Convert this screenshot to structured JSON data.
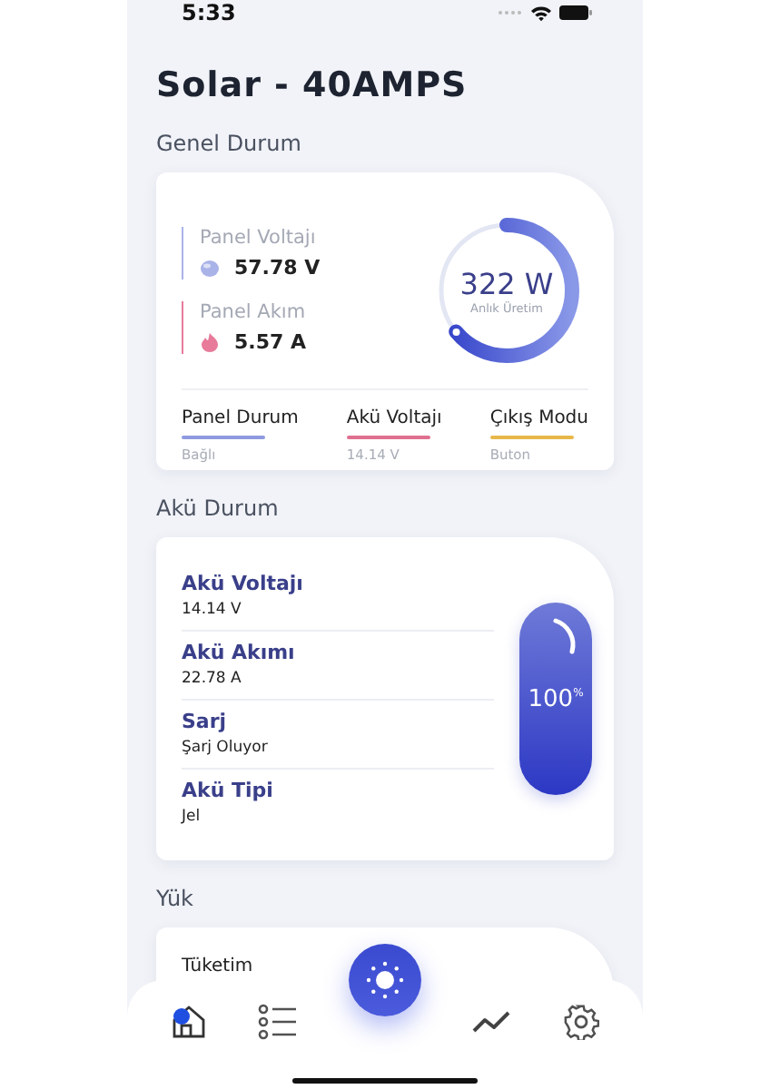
{
  "status_bar": {
    "time": "5:33"
  },
  "title": "Solar - 40AMPS",
  "general": {
    "heading": "Genel Durum",
    "metrics": [
      {
        "label": "Panel Voltajı",
        "value": "57.78 V",
        "color": "#a9b3e8"
      },
      {
        "label": "Panel Akım",
        "value": "5.57 A",
        "color": "#e87a9a"
      }
    ],
    "gauge": {
      "value": "322 W",
      "caption": "Anlık Üretim",
      "level": 0.64
    },
    "stats": [
      {
        "label": "Panel Durum",
        "value": "Bağlı",
        "color": "#8f9ae0"
      },
      {
        "label": "Akü Voltajı",
        "value": "14.14 V",
        "color": "#e0708f"
      },
      {
        "label": "Çıkış Modu",
        "value": "Buton",
        "color": "#e8b84a"
      }
    ]
  },
  "battery": {
    "heading": "Akü Durum",
    "rows": [
      {
        "label": "Akü Voltajı",
        "value": "14.14 V"
      },
      {
        "label": "Akü Akımı",
        "value": "22.78 A"
      },
      {
        "label": "Sarj",
        "value": "Şarj Oluyor"
      },
      {
        "label": "Akü Tipi",
        "value": "Jel"
      }
    ],
    "charge": {
      "value": "100",
      "unit": "%",
      "level": 1
    }
  },
  "load": {
    "heading": "Yük",
    "rows": [
      {
        "label": "Tüketim"
      }
    ]
  },
  "nav": [
    {
      "kind": "home",
      "selected": true
    },
    {
      "kind": "list",
      "selected": false
    },
    {
      "kind": "sun",
      "selected": false
    },
    {
      "kind": "chart",
      "selected": false
    },
    {
      "kind": "settings",
      "selected": false
    }
  ]
}
